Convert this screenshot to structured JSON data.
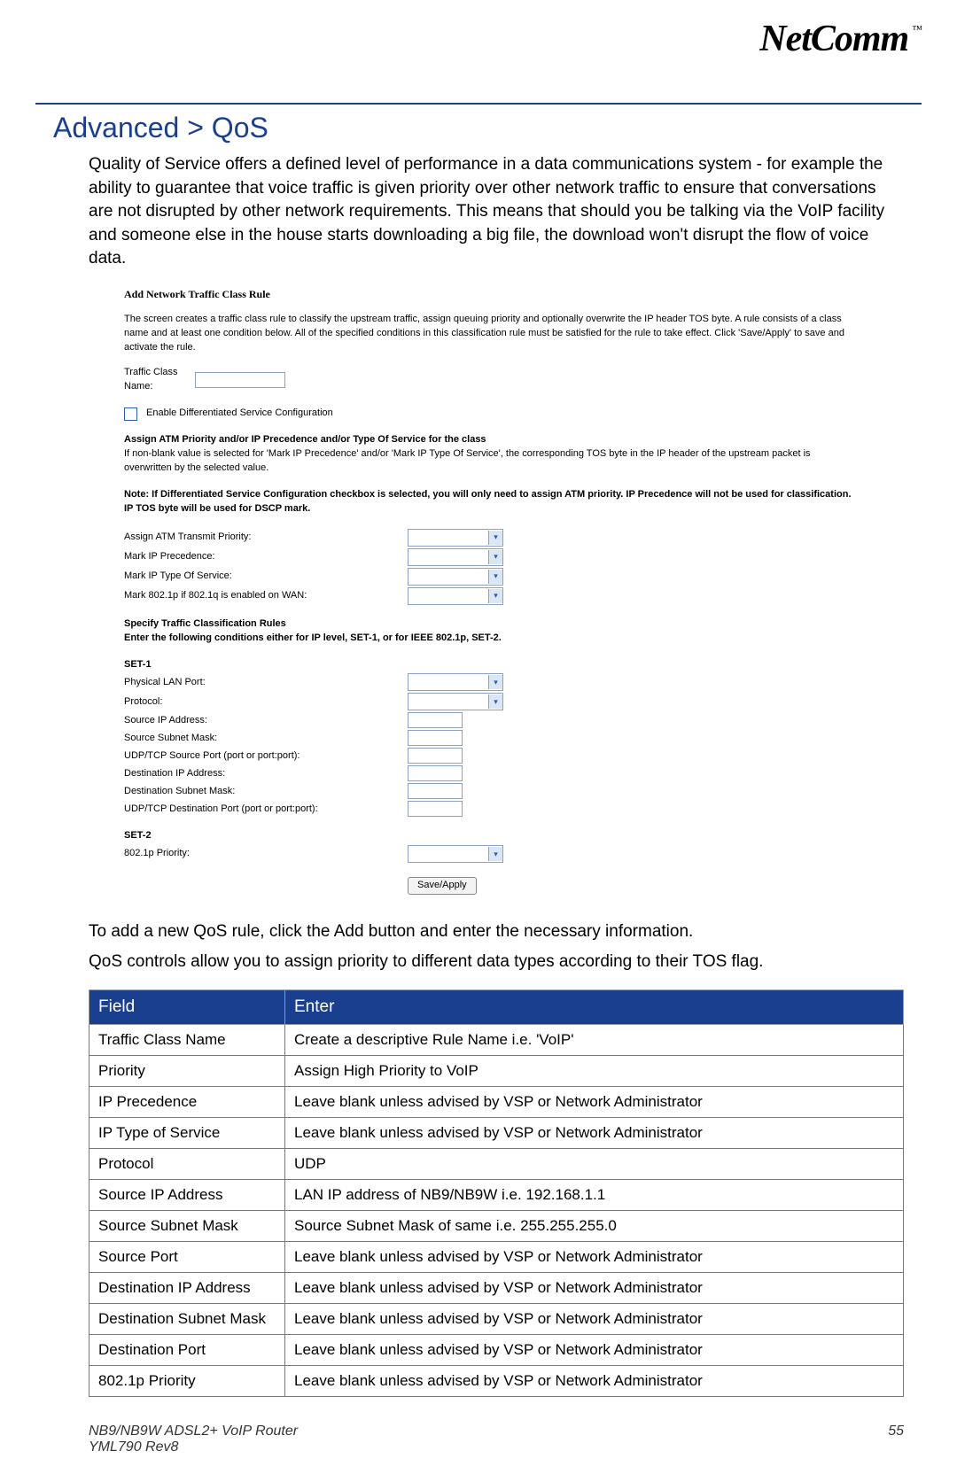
{
  "brand": "NetComm",
  "tm": "™",
  "page_title": "Advanced > QoS",
  "intro_text": "Quality of Service offers a defined level of performance in a data communications system - for example the ability to guarantee that voice traffic is given priority over other network traffic to ensure that conversations are not disrupted by other network requirements.  This means that should you be talking via the VoIP facility and someone else in the house starts downloading a big file, the download won't disrupt the flow of voice data.",
  "form": {
    "title": "Add Network Traffic Class Rule",
    "desc": "The screen creates a traffic class rule to classify the upstream traffic, assign queuing priority and optionally overwrite the IP header TOS byte. A rule consists of a class name and at least one condition below. All of the specified conditions in this classification rule must be satisfied for the rule to take effect. Click 'Save/Apply' to save and activate the rule.",
    "tcn_label": "Traffic Class Name:",
    "enable_dsc": "Enable Differentiated Service Configuration",
    "assign_header": "Assign ATM Priority and/or IP Precedence and/or Type Of Service for the class",
    "assign_note": "If non-blank value is selected for 'Mark IP Precedence' and/or 'Mark IP Type Of Service', the corresponding TOS byte in the IP header of the upstream packet is overwritten by the selected value.",
    "note": "Note: If Differentiated Service Configuration checkbox is selected, you will only need to assign ATM priority. IP Precedence will not be used for classification. IP TOS byte will be used for DSCP mark.",
    "atm_label": "Assign ATM Transmit Priority:",
    "mip_label": "Mark IP Precedence:",
    "mtos_label": "Mark IP Type Of Service:",
    "m8021p_label": "Mark 802.1p if 802.1q is enabled on WAN:",
    "spec_header": "Specify Traffic Classification Rules",
    "spec_sub": "Enter the following conditions either for IP level, SET-1, or for IEEE 802.1p, SET-2.",
    "set1": "SET-1",
    "lan_port": "Physical LAN Port:",
    "protocol": "Protocol:",
    "src_ip": "Source IP Address:",
    "src_mask": "Source Subnet Mask:",
    "udp_src": "UDP/TCP Source Port (port or port:port):",
    "dst_ip": "Destination IP Address:",
    "dst_mask": "Destination Subnet Mask:",
    "udp_dst": "UDP/TCP Destination Port (port or port:port):",
    "set2": "SET-2",
    "p8021": "802.1p Priority:",
    "save_btn": "Save/Apply"
  },
  "post_text_1": "To add a new QoS rule, click the Add button and enter the necessary information.",
  "post_text_2": "QoS controls allow you to assign priority to different data types according to their TOS flag.",
  "table": {
    "head_field": "Field",
    "head_enter": "Enter",
    "rows": [
      {
        "f": "Traffic Class Name",
        "e": "Create a descriptive Rule Name i.e. 'VoIP'"
      },
      {
        "f": "Priority",
        "e": "Assign High Priority to VoIP"
      },
      {
        "f": "IP Precedence",
        "e": "Leave blank unless advised by VSP or Network Administrator"
      },
      {
        "f": "IP Type of Service",
        "e": "Leave blank unless advised by VSP or Network Administrator"
      },
      {
        "f": "Protocol",
        "e": "UDP"
      },
      {
        "f": "Source IP Address",
        "e": "LAN IP address of NB9/NB9W i.e. 192.168.1.1"
      },
      {
        "f": "Source Subnet Mask",
        "e": "Source Subnet Mask of same i.e. 255.255.255.0"
      },
      {
        "f": "Source Port",
        "e": "Leave blank unless advised by VSP or Network Administrator"
      },
      {
        "f": "Destination IP Address",
        "e": "Leave blank unless advised by VSP or Network Administrator"
      },
      {
        "f": "Destination Subnet Mask",
        "e": "Leave blank unless advised by VSP or Network Administrator"
      },
      {
        "f": "Destination Port",
        "e": "Leave blank unless advised by VSP or Network Administrator"
      },
      {
        "f": "802.1p Priority",
        "e": "Leave blank unless advised by VSP or Network Administrator"
      }
    ]
  },
  "footer_left_1": "NB9/NB9W ADSL2+ VoIP Router",
  "footer_left_2": "YML790 Rev8",
  "footer_right": "55"
}
